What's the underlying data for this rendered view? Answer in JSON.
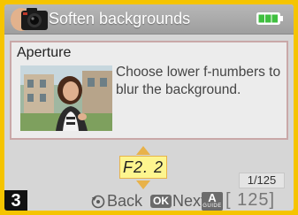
{
  "header": {
    "title": "Soften backgrounds",
    "mode_icon": "camera-icon",
    "battery_icon": "battery-full-icon"
  },
  "panel": {
    "title": "Aperture",
    "description": "Choose lower f-numbers to blur the background.",
    "image": "portrait-photo"
  },
  "setting": {
    "value": "F2. 2",
    "shutter_fraction": "1/125"
  },
  "footer": {
    "step": "3",
    "back_label": "Back",
    "ok_label": "OK",
    "next_label": "Next",
    "guide_letter": "A",
    "guide_label": "GUIDE",
    "remaining": "[ 125]"
  },
  "colors": {
    "frame": "#f5c400",
    "screen_bg": "#d6d6d6",
    "header_bg": "#a8a8a8",
    "value_highlight": "#fdf58f",
    "arrow": "#e8b24a",
    "battery": "#3fbf3f"
  }
}
